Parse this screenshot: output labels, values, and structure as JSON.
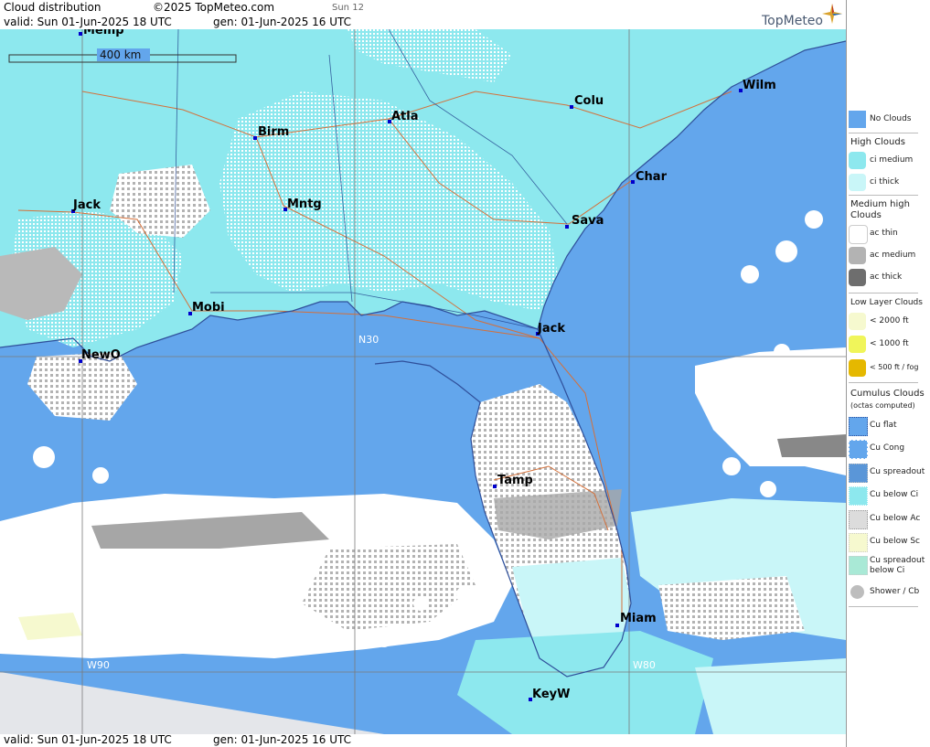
{
  "header": {
    "title": "Cloud distribution",
    "copyright": "©2025 TopMeteo.com",
    "day_tag": "Sun 12",
    "valid_line": "valid:  Sun  01-Jun-2025  18 UTC",
    "gen_line": "gen: 01-Jun-2025 16 UTC",
    "logo": "TopMeteo"
  },
  "footer": {
    "valid_line": "valid:  Sun  01-Jun-2025  18 UTC",
    "gen_line": "gen: 01-Jun-2025 16 UTC"
  },
  "map": {
    "scale_label": "400 km",
    "colors": {
      "no_clouds": "#63a6ec",
      "land_ci": "#8de8ee",
      "ci_thick": "#c9f6f8",
      "ac_thin": "#ffffff",
      "ac_medium": "#b3b3b3",
      "ac_thick": "#7f7f7f",
      "coast": "#2f4f9a",
      "roads": "#d4703a"
    },
    "grid_labels": [
      "N30",
      "W90",
      "W80"
    ],
    "cities": [
      {
        "name": "Wilm"
      },
      {
        "name": "Colu"
      },
      {
        "name": "Atla"
      },
      {
        "name": "Birm"
      },
      {
        "name": "Char"
      },
      {
        "name": "Jack"
      },
      {
        "name": "Mntg"
      },
      {
        "name": "Sava"
      },
      {
        "name": "Mobi"
      },
      {
        "name": "Jack"
      },
      {
        "name": "NewO"
      },
      {
        "name": "Tamp"
      },
      {
        "name": "Miam"
      },
      {
        "name": "KeyW"
      },
      {
        "name": "Memp"
      }
    ]
  },
  "legend": {
    "no_clouds": "No Clouds",
    "high_clouds_title": "High Clouds",
    "ci_medium": "ci medium",
    "ci_thick": "ci thick",
    "medium_high_title_1": "Medium high",
    "medium_high_title_2": "Clouds",
    "ac_thin": "ac thin",
    "ac_medium": "ac medium",
    "ac_thick": "ac thick",
    "low_layer_title": "Low Layer Clouds",
    "low_2000": "< 2000 ft",
    "low_1000": "< 1000 ft",
    "low_500": "< 500 ft / fog",
    "cumulus_title": "Cumulus Clouds",
    "cumulus_sub": "(octas computed)",
    "cu_flat": "Cu flat",
    "cu_cong": "Cu Cong",
    "cu_spreadout": "Cu spreadout",
    "cu_below_ci": "Cu below Ci",
    "cu_below_ac": "Cu below Ac",
    "cu_below_sc": "Cu below Sc",
    "cu_spread_ci_1": "Cu spreadout",
    "cu_spread_ci_2": "below Ci",
    "shower": "Shower / Cb"
  }
}
